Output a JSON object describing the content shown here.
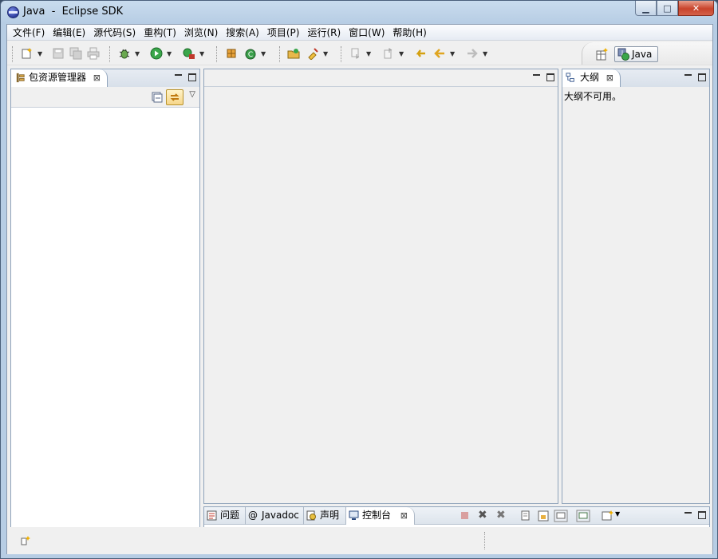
{
  "window": {
    "title": "Java  -  Eclipse SDK",
    "controls": {
      "minimize": "▁",
      "maximize": "□",
      "close": "✕"
    }
  },
  "menu": [
    "文件(F)",
    "编辑(E)",
    "源代码(S)",
    "重构(T)",
    "浏览(N)",
    "搜索(A)",
    "项目(P)",
    "运行(R)",
    "窗口(W)",
    "帮助(H)"
  ],
  "perspective": {
    "label": "Java"
  },
  "views": {
    "package_explorer": {
      "title": "包资源管理器"
    },
    "outline": {
      "title": "大纲",
      "message": "大纲不可用。"
    }
  },
  "bottom_tabs": [
    "问题",
    "Javadoc",
    "声明",
    "控制台"
  ],
  "icons": {
    "close_tab": "⊠"
  }
}
